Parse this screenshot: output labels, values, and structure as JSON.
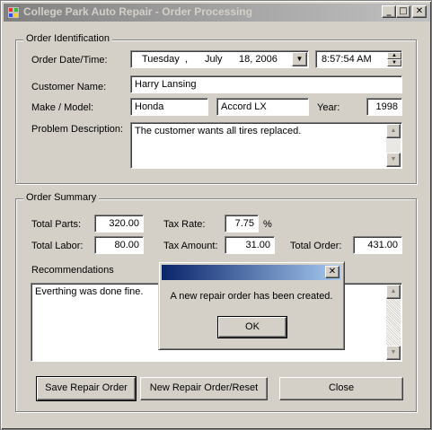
{
  "window": {
    "title": "College Park Auto Repair - Order Processing",
    "minimize_glyph": "_",
    "maximize_glyph": "□",
    "close_glyph": "✕"
  },
  "identification": {
    "group_title": "Order Identification",
    "date_label": "Order Date/Time:",
    "date_weekday": "Tuesday",
    "date_sep": ",",
    "date_month": "July",
    "date_dayyear": "18, 2006",
    "time_value": "8:57:54 AM",
    "customer_label": "Customer Name:",
    "customer_value": "Harry Lansing",
    "make_model_label": "Make / Model:",
    "make_value": "Honda",
    "model_value": "Accord LX",
    "year_label": "Year:",
    "year_value": "1998",
    "problem_label": "Problem Description:",
    "problem_value": "The customer wants all tires replaced."
  },
  "summary": {
    "group_title": "Order Summary",
    "total_parts_label": "Total Parts:",
    "total_parts_value": "320.00",
    "total_labor_label": "Total Labor:",
    "total_labor_value": "80.00",
    "tax_rate_label": "Tax Rate:",
    "tax_rate_value": "7.75",
    "tax_rate_unit": "%",
    "tax_amount_label": "Tax Amount:",
    "tax_amount_value": "31.00",
    "total_order_label": "Total Order:",
    "total_order_value": "431.00",
    "recommendations_label": "Recommendations",
    "recommendations_value": "Everthing was done fine."
  },
  "buttons": {
    "save": "Save Repair Order",
    "new": "New Repair Order/Reset",
    "close": "Close"
  },
  "dialog": {
    "message": "A new repair order has been created.",
    "ok": "OK",
    "close_glyph": "✕"
  },
  "colors": {
    "dialog_title_active": "#0a246a",
    "window_title_inactive": "#808080",
    "face": "#d4d0c8"
  }
}
